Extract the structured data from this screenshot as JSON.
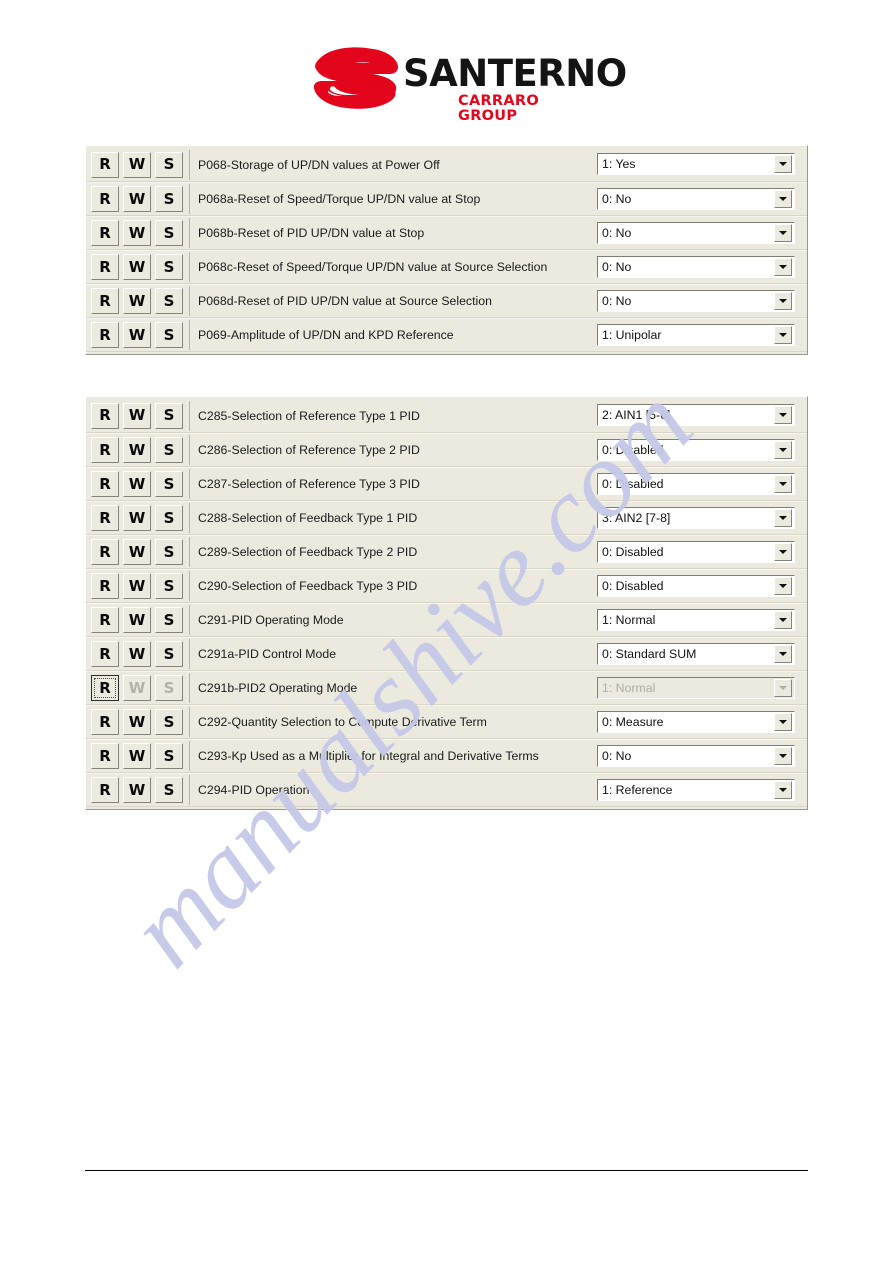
{
  "page": {
    "watermark_text": "manualshive.com",
    "watermark_color": "#c5c9e8",
    "background_color": "#ffffff",
    "panel_background_color": "#ece9df"
  },
  "logo": {
    "wordmark": "SANTERNO",
    "tagline": "CARRARO GROUP",
    "mark_icon": "santerno-s-logo-icon",
    "wordmark_color": "#141414",
    "tagline_color": "#e3051b",
    "mark_color": "#e3051b"
  },
  "buttons": {
    "read_label": "R",
    "write_label": "W",
    "save_label": "S"
  },
  "panels": [
    {
      "id": "panel-up-dn-parameters",
      "rows": [
        {
          "label": "P068-Storage of UP/DN values at Power Off",
          "value": "1: Yes",
          "disabled": false,
          "focused": false
        },
        {
          "label": "P068a-Reset of Speed/Torque UP/DN value at Stop",
          "value": "0: No",
          "disabled": false,
          "focused": false
        },
        {
          "label": "P068b-Reset of PID UP/DN value at Stop",
          "value": "0: No",
          "disabled": false,
          "focused": false
        },
        {
          "label": "P068c-Reset of Speed/Torque UP/DN value at Source Selection",
          "value": "0: No",
          "disabled": false,
          "focused": false
        },
        {
          "label": "P068d-Reset of PID UP/DN value at Source Selection",
          "value": "0: No",
          "disabled": false,
          "focused": false
        },
        {
          "label": "P069-Amplitude of UP/DN and KPD Reference",
          "value": "1: Unipolar",
          "disabled": false,
          "focused": false
        }
      ]
    },
    {
      "id": "panel-pid-configuration",
      "rows": [
        {
          "label": "C285-Selection of Reference Type 1 PID",
          "value": "2: AIN1 [5-6]",
          "disabled": false,
          "focused": false
        },
        {
          "label": "C286-Selection of Reference Type 2 PID",
          "value": "0: Disabled",
          "disabled": false,
          "focused": false
        },
        {
          "label": "C287-Selection of Reference Type 3 PID",
          "value": "0: Disabled",
          "disabled": false,
          "focused": false
        },
        {
          "label": "C288-Selection of Feedback Type 1 PID",
          "value": "3: AIN2 [7-8]",
          "disabled": false,
          "focused": false
        },
        {
          "label": "C289-Selection of Feedback Type 2 PID",
          "value": "0: Disabled",
          "disabled": false,
          "focused": false
        },
        {
          "label": "C290-Selection of Feedback Type 3 PID",
          "value": "0: Disabled",
          "disabled": false,
          "focused": false
        },
        {
          "label": "C291-PID Operating Mode",
          "value": "1: Normal",
          "disabled": false,
          "focused": false
        },
        {
          "label": "C291a-PID Control Mode",
          "value": "0: Standard SUM",
          "disabled": false,
          "focused": false
        },
        {
          "label": "C291b-PID2 Operating Mode",
          "value": "1: Normal",
          "disabled": true,
          "focused": true
        },
        {
          "label": "C292-Quantity Selection to Compute Derivative Term",
          "value": "0: Measure",
          "disabled": false,
          "focused": false
        },
        {
          "label": "C293-Kp Used as a Multiplier for Integral and Derivative Terms",
          "value": "0: No",
          "disabled": false,
          "focused": false
        },
        {
          "label": "C294-PID Operation",
          "value": "1: Reference",
          "disabled": false,
          "focused": false
        }
      ]
    }
  ]
}
